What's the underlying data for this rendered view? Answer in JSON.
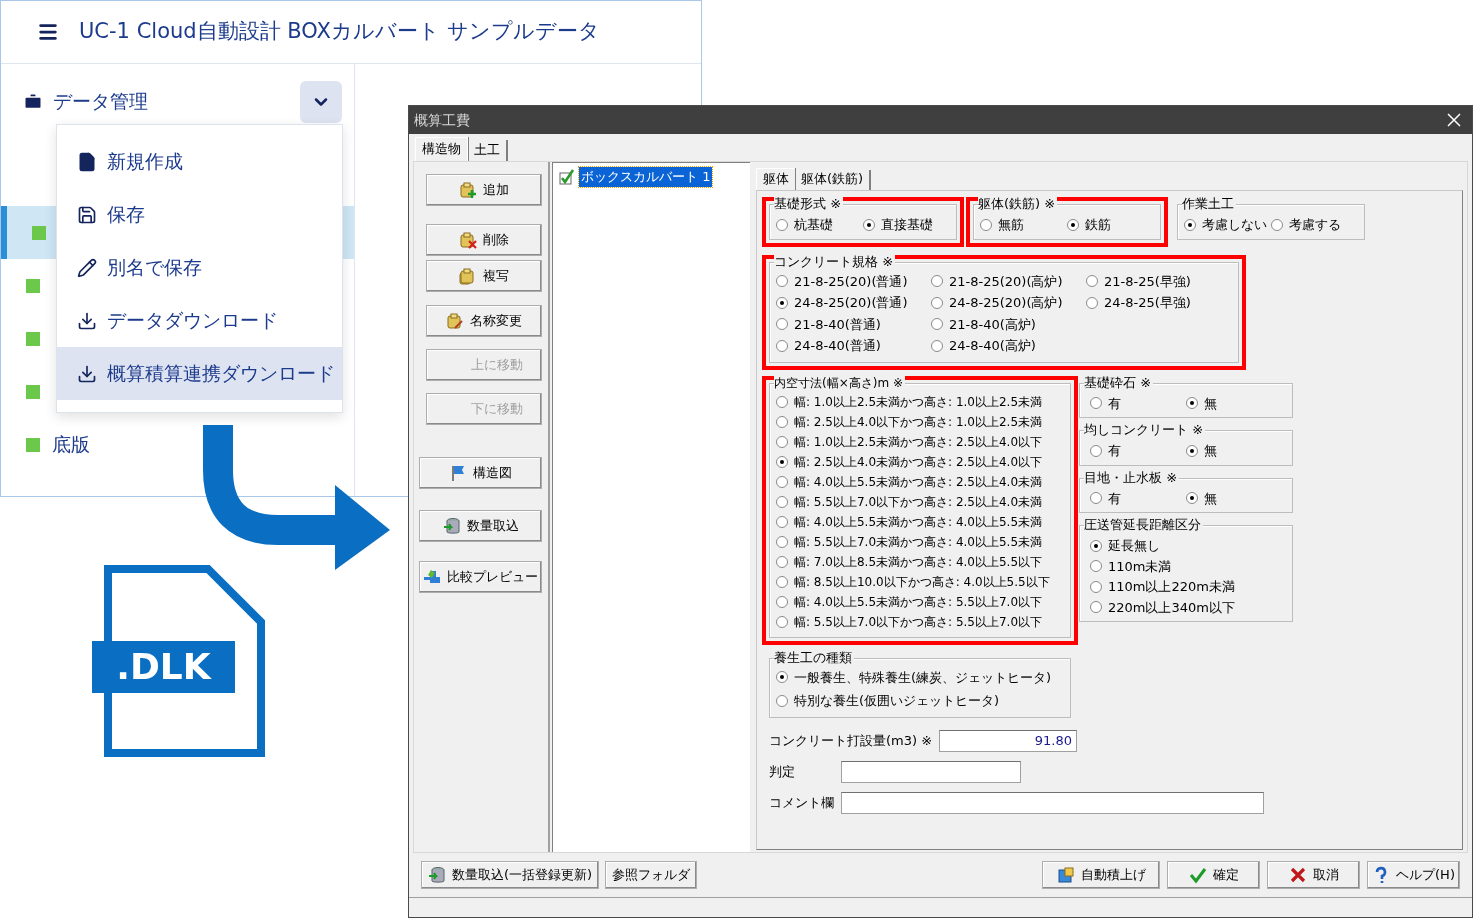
{
  "web_app": {
    "title": "UC-1 Cloud自動設計 BOXカルバート サンプルデータ",
    "section": "データ管理",
    "sidebar_items": [
      {
        "selected": true
      },
      {
        "selected": false
      },
      {
        "selected": false
      },
      {
        "selected": false
      },
      {
        "label": "底版",
        "selected": false
      }
    ],
    "menu_items": [
      {
        "label": "新規作成",
        "kind": "new",
        "selected": false
      },
      {
        "label": "保存",
        "kind": "save",
        "selected": false
      },
      {
        "label": "別名で保存",
        "kind": "rename",
        "selected": false
      },
      {
        "label": "データダウンロード",
        "kind": "download",
        "selected": false
      },
      {
        "label": "概算積算連携ダウンロード",
        "kind": "download",
        "selected": true
      }
    ]
  },
  "file_badge": ".DLK",
  "dialog": {
    "title": "概算工費",
    "tabs": [
      {
        "label": "構造物",
        "selected": true
      },
      {
        "label": "土工",
        "selected": false
      }
    ],
    "side_buttons": [
      {
        "label": "追加",
        "kind": "add",
        "disabled": false
      },
      {
        "label": "削除",
        "kind": "delete",
        "disabled": false
      },
      {
        "label": "複写",
        "kind": "copy",
        "disabled": false
      },
      {
        "label": "名称変更",
        "kind": "rename",
        "disabled": false
      },
      {
        "label": "上に移動",
        "kind": "plain",
        "disabled": true
      },
      {
        "label": "下に移動",
        "kind": "plain",
        "disabled": true
      },
      {
        "label": "構造図",
        "kind": "flag",
        "disabled": false
      },
      {
        "label": "数量取込",
        "kind": "import",
        "disabled": false
      },
      {
        "label": "比較プレビュー",
        "kind": "compare",
        "disabled": false
      }
    ],
    "tree_items": [
      {
        "label": "ボックスカルバート 1",
        "checked": true,
        "selected": true
      }
    ],
    "panel_tabs": [
      {
        "label": "躯体",
        "selected": true
      },
      {
        "label": "躯体(鉄筋)",
        "selected": false
      }
    ],
    "top_groups": [
      {
        "title": "基礎形式 ※",
        "highlight": true,
        "options": [
          {
            "label": "杭基礎",
            "selected": false
          },
          {
            "label": "直接基礎",
            "selected": true
          }
        ]
      },
      {
        "title": "躯体(鉄筋) ※",
        "highlight": true,
        "options": [
          {
            "label": "無筋",
            "selected": false
          },
          {
            "label": "鉄筋",
            "selected": true
          }
        ]
      },
      {
        "title": "作業土工",
        "highlight": false,
        "options": [
          {
            "label": "考慮しない",
            "selected": true
          },
          {
            "label": "考慮する",
            "selected": false
          }
        ]
      }
    ],
    "grade_group": {
      "title": "コンクリート規格 ※",
      "highlight": true,
      "rows": [
        [
          {
            "label": "21-8-25(20)(普通)",
            "selected": false
          },
          {
            "label": "21-8-25(20)(高炉)",
            "selected": false
          },
          {
            "label": "21-8-25(早強)",
            "selected": false
          }
        ],
        [
          {
            "label": "24-8-25(20)(普通)",
            "selected": true
          },
          {
            "label": "24-8-25(20)(高炉)",
            "selected": false
          },
          {
            "label": "24-8-25(早強)",
            "selected": false
          }
        ],
        [
          {
            "label": "21-8-40(普通)",
            "selected": false
          },
          {
            "label": "21-8-40(高炉)",
            "selected": false
          }
        ],
        [
          {
            "label": "24-8-40(普通)",
            "selected": false
          },
          {
            "label": "24-8-40(高炉)",
            "selected": false
          }
        ]
      ]
    },
    "left_groups": [
      {
        "title": "内空寸法(幅×高さ)m ※",
        "highlight": true,
        "options": [
          {
            "label": "幅: 1.0以上2.5未満かつ高さ: 1.0以上2.5未満",
            "selected": false
          },
          {
            "label": "幅: 2.5以上4.0以下かつ高さ: 1.0以上2.5未満",
            "selected": false
          },
          {
            "label": "幅: 1.0以上2.5未満かつ高さ: 2.5以上4.0以下",
            "selected": false
          },
          {
            "label": "幅: 2.5以上4.0未満かつ高さ: 2.5以上4.0以下",
            "selected": true
          },
          {
            "label": "幅: 4.0以上5.5未満かつ高さ: 2.5以上4.0未満",
            "selected": false
          },
          {
            "label": "幅: 5.5以上7.0以下かつ高さ: 2.5以上4.0未満",
            "selected": false
          },
          {
            "label": "幅: 4.0以上5.5未満かつ高さ: 4.0以上5.5未満",
            "selected": false
          },
          {
            "label": "幅: 5.5以上7.0未満かつ高さ: 4.0以上5.5未満",
            "selected": false
          },
          {
            "label": "幅: 7.0以上8.5未満かつ高さ: 4.0以上5.5以下",
            "selected": false
          },
          {
            "label": "幅: 8.5以上10.0以下かつ高さ: 4.0以上5.5以下",
            "selected": false
          },
          {
            "label": "幅: 4.0以上5.5未満かつ高さ: 5.5以上7.0以下",
            "selected": false
          },
          {
            "label": "幅: 5.5以上7.0以下かつ高さ: 5.5以上7.0以下",
            "selected": false
          }
        ]
      },
      {
        "title": "養生工の種類",
        "highlight": false,
        "options": [
          {
            "label": "一般養生、特殊養生(練炭、ジェットヒータ)",
            "selected": true
          },
          {
            "label": "特別な養生(仮囲いジェットヒータ)",
            "selected": false
          }
        ]
      }
    ],
    "right_groups": [
      {
        "title": "基礎砕石 ※",
        "kind": "inline",
        "options": [
          {
            "label": "有",
            "selected": false
          },
          {
            "label": "無",
            "selected": true
          }
        ]
      },
      {
        "title": "均しコンクリート ※",
        "kind": "inline",
        "options": [
          {
            "label": "有",
            "selected": false
          },
          {
            "label": "無",
            "selected": true
          }
        ]
      },
      {
        "title": "目地・止水板 ※",
        "kind": "inline",
        "options": [
          {
            "label": "有",
            "selected": false
          },
          {
            "label": "無",
            "selected": true
          }
        ]
      },
      {
        "title": "圧送管延長距離区分",
        "kind": "list",
        "options": [
          {
            "label": "延長無し",
            "selected": true
          },
          {
            "label": "110m未満",
            "selected": false
          },
          {
            "label": "110m以上220m未満",
            "selected": false
          },
          {
            "label": "220m以上340m以下",
            "selected": false
          }
        ]
      }
    ],
    "fields": [
      {
        "label": "コンクリート打設量(m3) ※",
        "value": "91.80"
      },
      {
        "label": "判定"
      },
      {
        "label": "コメント欄"
      }
    ],
    "bottom_left_buttons": [
      {
        "label": "数量取込(一括登録更新)",
        "kind": "import"
      },
      {
        "label": "参照フォルダ",
        "kind": "plain"
      }
    ],
    "bottom_right_buttons": [
      {
        "label": "自動積上げ",
        "kind": "auto"
      },
      {
        "label": "確定",
        "kind": "ok"
      },
      {
        "label": "取消",
        "kind": "cancel"
      },
      {
        "label": "ヘルプ(H)",
        "kind": "help"
      }
    ]
  }
}
